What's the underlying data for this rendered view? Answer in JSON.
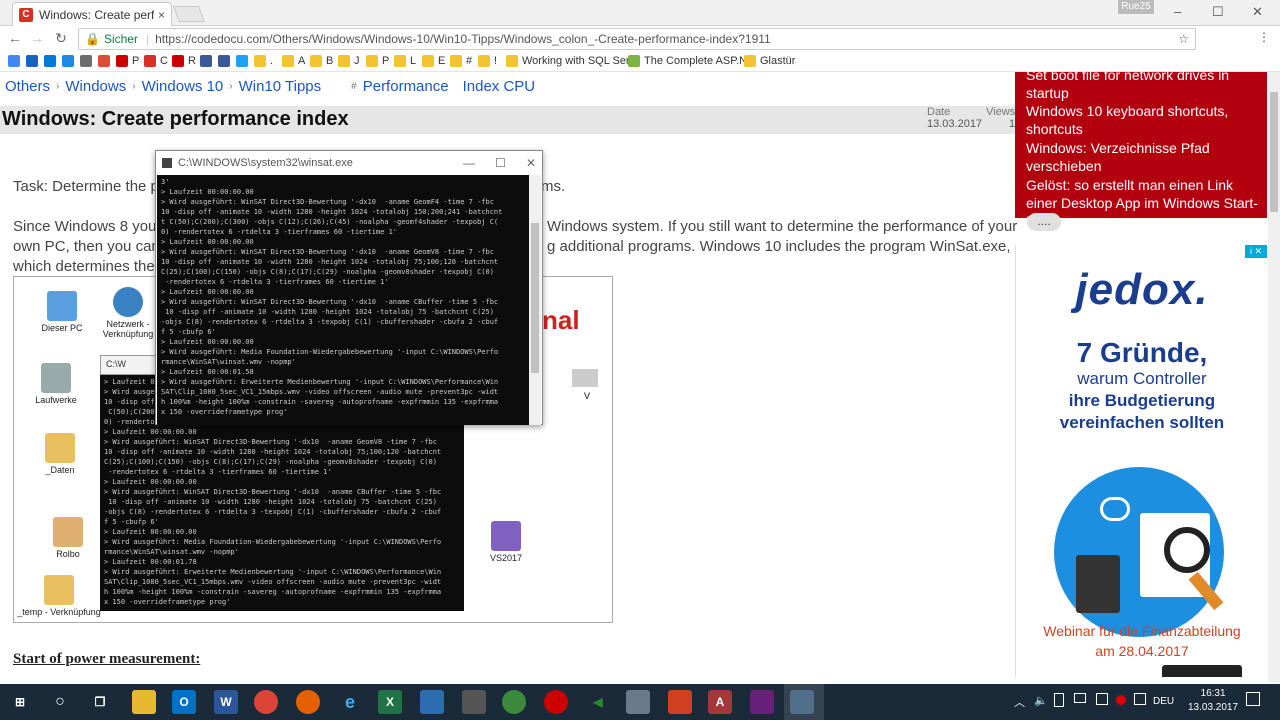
{
  "browser": {
    "tab_title": "Windows: Create perform",
    "tab_close": "×",
    "profile": "Rue25",
    "url_secure_label": "Sicher",
    "url": "https://codedocu.com/Others/Windows/Windows-10/Win10-Tipps/Windows_colon_-Create-performance-index?1911",
    "window_controls": [
      "–",
      "☐",
      "✕"
    ]
  },
  "bookmarks": [
    {
      "label": "",
      "color": "#4285f4"
    },
    {
      "label": "",
      "color": "#1565c0"
    },
    {
      "label": "",
      "color": "#0078d7"
    },
    {
      "label": "",
      "color": "#1e88e5"
    },
    {
      "label": "",
      "color": "#6d6d6d"
    },
    {
      "label": "",
      "color": "#dd4b39"
    },
    {
      "label": "P",
      "color": "#cc0000"
    },
    {
      "label": "C",
      "color": "#d93025"
    },
    {
      "label": "R",
      "color": "#cc0000"
    },
    {
      "label": "",
      "color": "#3b5998"
    },
    {
      "label": "",
      "color": "#3b5998"
    },
    {
      "label": "",
      "color": "#1da1f2"
    },
    {
      "label": ".",
      "color": "#f4c430"
    },
    {
      "label": "A",
      "color": "#f4c430"
    },
    {
      "label": "B",
      "color": "#f4c430"
    },
    {
      "label": "J",
      "color": "#f4c430"
    },
    {
      "label": "P",
      "color": "#f4c430"
    },
    {
      "label": "L",
      "color": "#f4c430"
    },
    {
      "label": "E",
      "color": "#f4c430"
    },
    {
      "label": "#",
      "color": "#f4c430"
    },
    {
      "label": "!",
      "color": "#f4c430"
    },
    {
      "label": "Working with SQL Ser",
      "color": "#f4c430"
    },
    {
      "label": "The Complete ASP.NE",
      "color": "#7cb342"
    },
    {
      "label": "Glastür",
      "color": "#f4c430"
    }
  ],
  "breadcrumb": [
    "Others",
    "Windows",
    "Windows 10",
    "Win10 Tipps",
    "Performance",
    "Index CPU"
  ],
  "breadcrumb_hash": "#",
  "article": {
    "title": "Windows: Create performance index",
    "date_label": "Date",
    "date_value": "13.03.2017",
    "views_label": "Views",
    "views_value": "1",
    "task_text": "Task: Determine the p",
    "task_text_end": "ms.",
    "para_line1_start": "Since Windows 8 you",
    "para_line1_end": "Windows system. If you still want to determine the performance of your",
    "para_line2_start": "own PC, then you can",
    "para_line2_end": "g additional programs. Windows 10 includes the program WinSat.exe,",
    "para_line3_start": "which determines the",
    "section_heading": "Start of power measurement:"
  },
  "embedded_screenshot": {
    "icons": [
      "Dieser PC",
      "Netzwerk - Verknüpfung",
      "Laufwerke",
      "_Daten",
      "Rolbo",
      "VS2017",
      "_temp - Verknüpfung"
    ],
    "inner_window_title": "C:\\W",
    "banner_text": "nal",
    "right_label": "V",
    "console_lines": [
      "> Laufzeit 00:00:00.00",
      "> Wird ausgeführt: WinSAT Direct3D-Bewertung '-dx10  -aname GeomF4 -time 7 -fbc",
      "10 -disp off -animate 10 -width 1280 -height 1024 -totalobj 150;200;241 -batchcnt",
      " C(50);C(200);C(300) -objs C(12);C(26);C(45) -noalpha -geomf4shader -texpobj C(",
      "0) -rendertotex 6 -rtdelta 3 -tierframes 60 -tiertime 1'",
      "> Laufzeit 00:00:00.00",
      "> Wird ausgeführt: WinSAT Direct3D-Bewertung '-dx10  -aname GeomV8 -time 7 -fbc",
      "10 -disp off -animate 10 -width 1280 -height 1024 -totalobj 75;100;120 -batchcnt",
      "C(25);C(100);C(150) -objs C(8);C(17);C(29) -noalpha -geomv8shader -texpobj C(0)",
      " -rendertotex 6 -rtdelta 3 -tierframes 60 -tiertime 1'",
      "> Laufzeit 00:00:00.00",
      "> Wird ausgeführt: WinSAT Direct3D-Bewertung '-dx10  -aname CBuffer -time 5 -fbc",
      " 10 -disp off -animate 10 -width 1280 -height 1024 -totalobj 75 -batchcnt C(25)",
      "-objs C(8) -rendertotex 6 -rtdelta 3 -texpobj C(1) -cbuffershader -cbufa 2 -cbuf",
      "f 5 -cbufp 6'",
      "> Laufzeit 00:00:00.00",
      "> Wird ausgeführt: Media Foundation-Wiedergabebewertung '-input C:\\WINDOWS\\Perfo",
      "rmance\\WinSAT\\winsat.wmv -nopmp'",
      "> Laufzeit 00:00:01.78",
      "> Wird ausgeführt: Erweiterte Medienbewertung '-input C:\\WINDOWS\\Performance\\Win",
      "SAT\\Clip_1080_5sec_VC1_15mbps.wmv -video offscreen -audio mute -prevent3pc -widt",
      "h 100%m -height 100%m -constrain -savereg -autoprofname -expfrmmin 135 -expfrmma",
      "x 150 -overrideframetype prog'"
    ]
  },
  "winsat_window": {
    "title": "C:\\WINDOWS\\system32\\winsat.exe",
    "controls": [
      "—",
      "☐",
      "✕"
    ],
    "lines": [
      "3'",
      "> Laufzeit 00:00:00.00",
      "> Wird ausgeführt: WinSAT Direct3D-Bewertung '-dx10  -aname GeomF4 -time 7 -fbc",
      "10 -disp off -animate 10 -width 1280 -height 1024 -totalobj 150;200;241 -batchcnt",
      "t C(50);C(200);C(300) -objs C(12);C(26);C(45) -noalpha -geomf4shader -texpobj C(",
      "0) -rendertotex 6 -rtdelta 3 -tierframes 60 -tiertime 1'",
      "> Laufzeit 00:00:00.00",
      "> Wird ausgeführt: WinSAT Direct3D-Bewertung '-dx10  -aname GeomV8 -time 7 -fbc",
      "10 -disp off -animate 10 -width 1280 -height 1024 -totalobj 75;100;120 -batchcnt",
      "C(25);C(100);C(150) -objs C(8);C(17);C(29) -noalpha -geomv8shader -texpobj C(0)",
      " -rendertotex 6 -rtdelta 3 -tierframes 60 -tiertime 1'",
      "> Laufzeit 00:00:00.00",
      "> Wird ausgeführt: WinSAT Direct3D-Bewertung '-dx10  -aname CBuffer -time 5 -fbc",
      " 10 -disp off -animate 10 -width 1280 -height 1024 -totalobj 75 -batchcnt C(25)",
      "-objs C(8) -rendertotex 6 -rtdelta 3 -texpobj C(1) -cbuffershader -cbufa 2 -cbuf",
      "f 5 -cbufp 6'",
      "> Laufzeit 00:00:00.00",
      "> Wird ausgeführt: Media Foundation-Wiedergabebewertung '-input C:\\WINDOWS\\Perfo",
      "rmance\\WinSAT\\winsat.wmv -nopmp'",
      "> Laufzeit 00:00:01.58",
      "> Wird ausgeführt: Erweiterte Medienbewertung '-input C:\\WINDOWS\\Performance\\Win",
      "SAT\\Clip_1080_5sec_VC1_15mbps.wmv -video offscreen -audio mute -prevent3pc -widt",
      "h 100%m -height 100%m -constrain -savereg -autoprofname -expfrmmin 135 -expfrmma",
      "x 150 -overrideframetype prog'"
    ]
  },
  "sidebar": {
    "links": [
      "Set boot file for network drives in startup",
      "Windows 10 keyboard shortcuts, shortcuts",
      "Windows: Verzeichnisse Pfad verschieben",
      "Gelöst: so erstellt man einen Link einer Desktop App im Windows Start-Menü"
    ],
    "more_label": "....",
    "bg_color": "#b3000f"
  },
  "ad": {
    "brand": "jedox.",
    "line1": "7 Gründe,",
    "line2": "warum Controller",
    "line3": "ihre Budgetierung",
    "line4": "vereinfachen sollten",
    "webinar1": "Webinar für die Finanzabteilung",
    "webinar2": "am 28.04.2017",
    "close_marker": "i ✕"
  },
  "taskbar": {
    "language": "DEU",
    "time": "16:31",
    "date": "13.03.2017"
  }
}
